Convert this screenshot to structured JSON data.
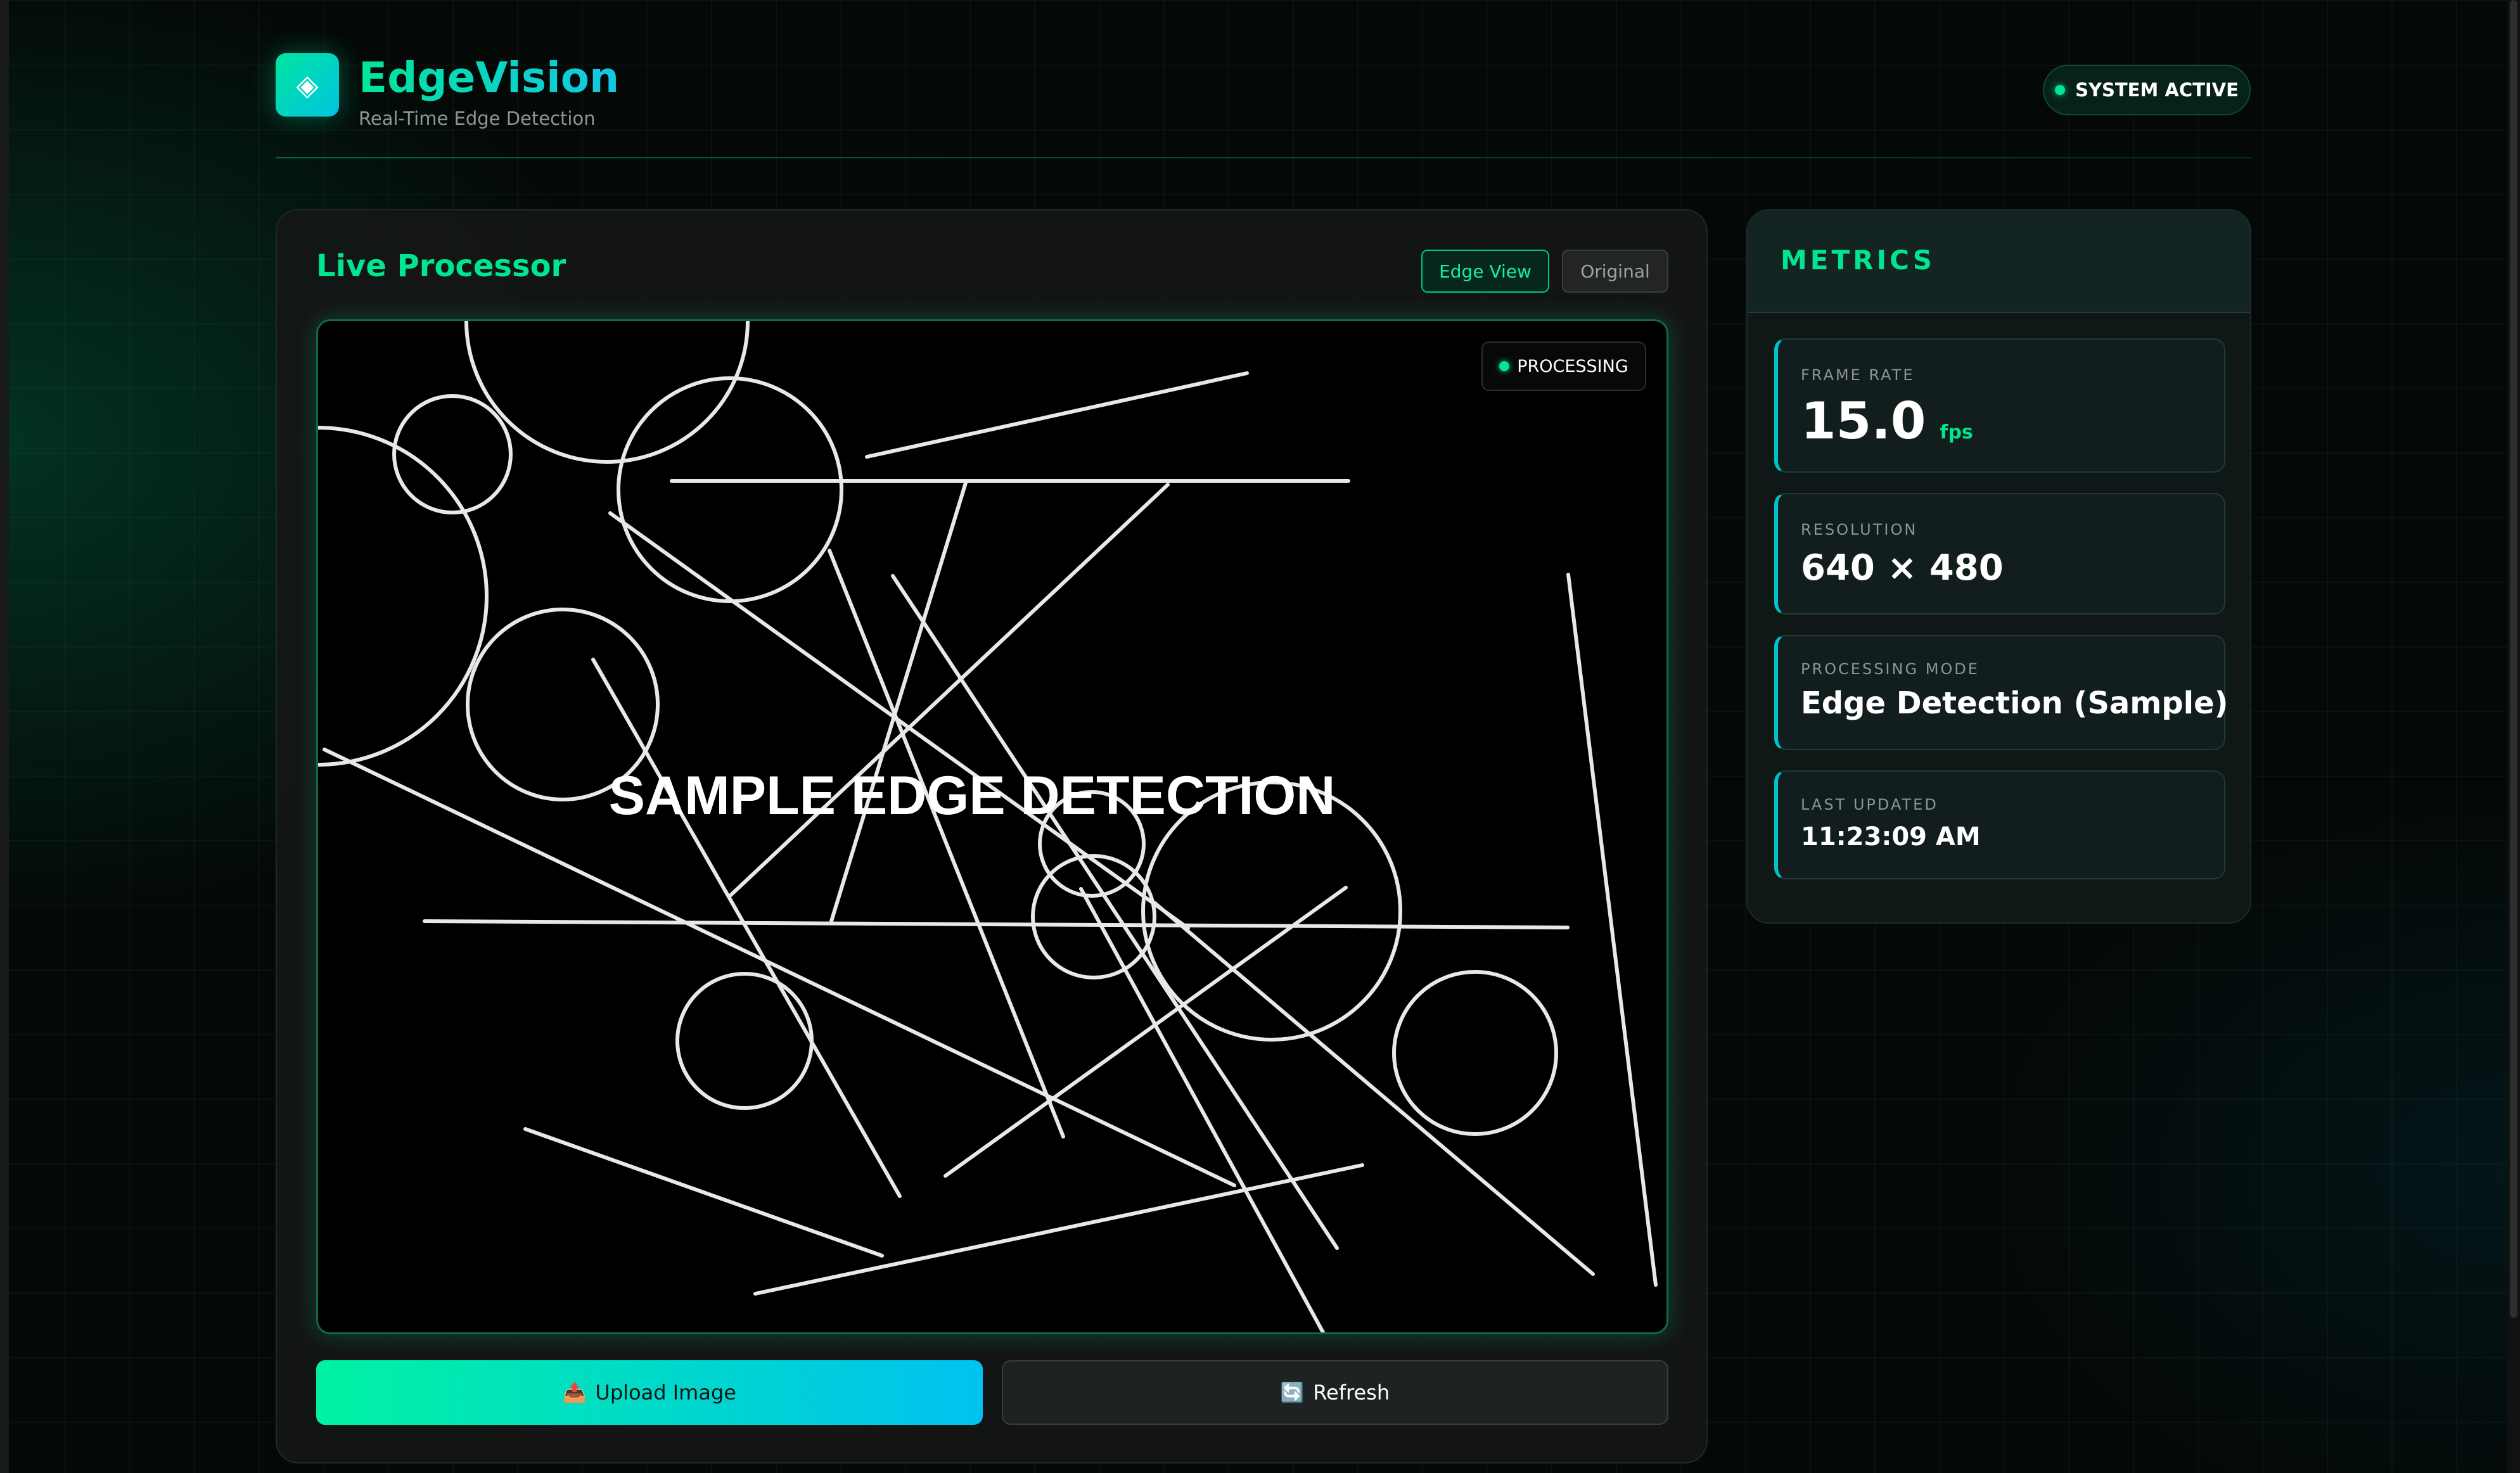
{
  "header": {
    "logo_icon": "diamond-icon",
    "title": "EdgeVision",
    "subtitle": "Real-Time Edge Detection",
    "status": "SYSTEM ACTIVE",
    "status_color": "#00e592"
  },
  "processor": {
    "title": "Live Processor",
    "view_edge_label": "Edge View",
    "view_original_label": "Original",
    "badge_label": "PROCESSING",
    "canvas_text": "SAMPLE EDGE DETECTION",
    "upload_icon": "📤",
    "upload_label": "Upload Image",
    "refresh_icon": "🔄",
    "refresh_label": "Refresh"
  },
  "metrics": {
    "title": "METRICS",
    "items": [
      {
        "label": "FRAME RATE",
        "value": "15.0",
        "unit": "fps"
      },
      {
        "label": "RESOLUTION",
        "value": "640 × 480"
      },
      {
        "label": "PROCESSING MODE",
        "value": "Edge Detection (Sample)"
      },
      {
        "label": "LAST UPDATED",
        "value": "11:23:09 AM"
      }
    ]
  },
  "colors": {
    "accent_green": "#00e58f",
    "accent_cyan": "#00c2f0",
    "background": "#040807"
  }
}
